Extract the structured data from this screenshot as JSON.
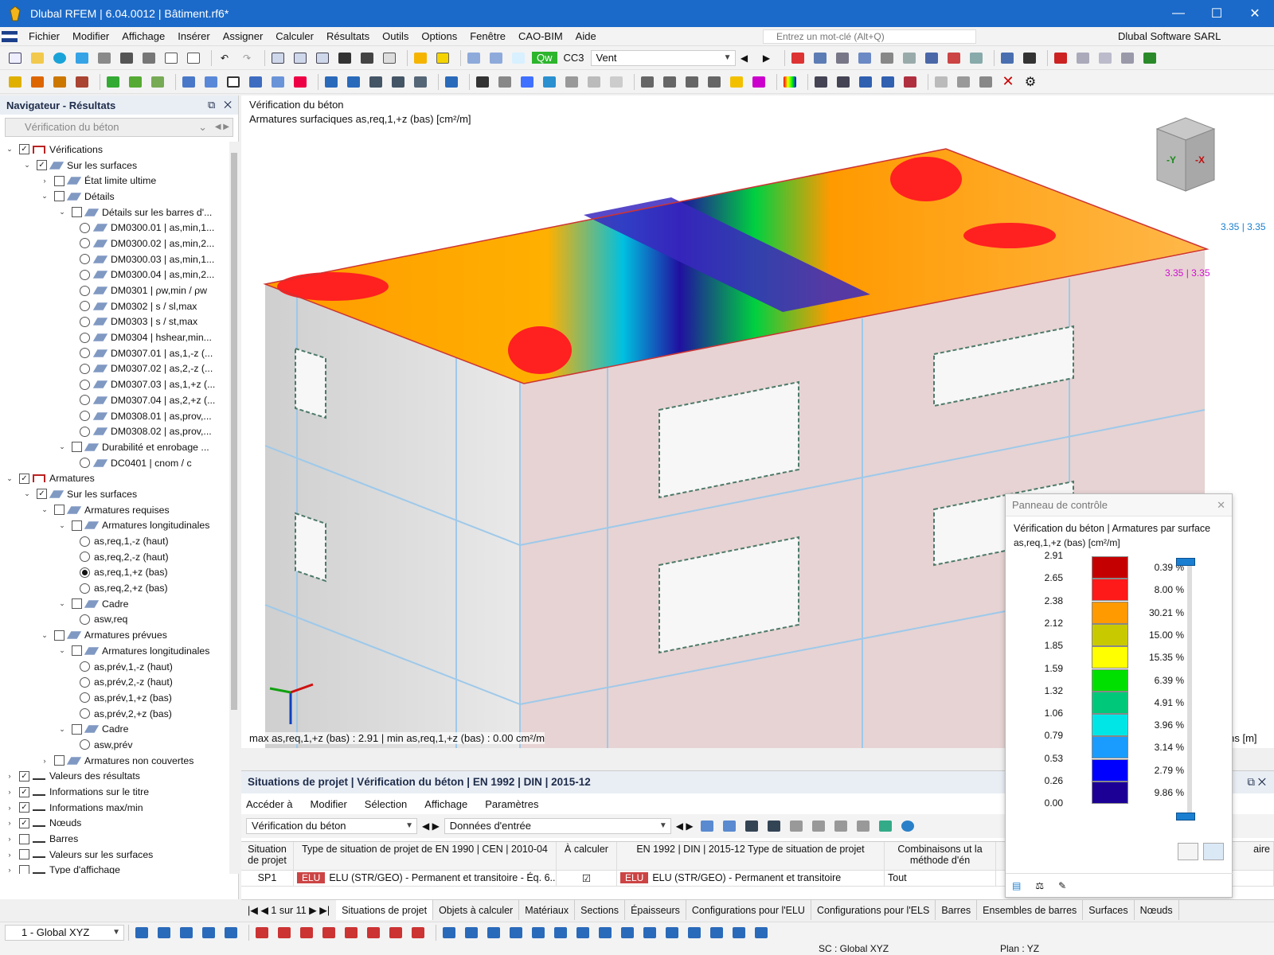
{
  "window": {
    "title": "Dlubal RFEM | 6.04.0012 | Bâtiment.rf6*",
    "minimize": "—",
    "maximize": "☐",
    "close": "✕"
  },
  "menu": {
    "items": [
      "Fichier",
      "Modifier",
      "Affichage",
      "Insérer",
      "Assigner",
      "Calculer",
      "Résultats",
      "Outils",
      "Options",
      "Fenêtre",
      "CAO-BIM",
      "Aide"
    ],
    "search_placeholder": "Entrez un mot-clé (Alt+Q)",
    "company": "Dlubal Software SARL"
  },
  "toolbar": {
    "load_case_code": "Qw",
    "load_case_id": "CC3",
    "load_case_name": "Vent"
  },
  "navigator": {
    "title": "Navigateur - Résultats",
    "selector": "Vérification du béton",
    "tree": [
      {
        "level": 0,
        "exp": "v",
        "check": "checked",
        "icon": "check",
        "label": "Vérifications"
      },
      {
        "level": 1,
        "exp": "v",
        "check": "checked",
        "icon": "surf",
        "label": "Sur les surfaces"
      },
      {
        "level": 2,
        "exp": ">",
        "check": "empty",
        "icon": "surf",
        "label": "État limite ultime"
      },
      {
        "level": 2,
        "exp": "v",
        "check": "empty",
        "icon": "surf",
        "label": "Détails"
      },
      {
        "level": 3,
        "exp": "v",
        "check": "empty",
        "icon": "surf",
        "label": "Détails sur les barres d'..."
      },
      {
        "level": 4,
        "radio": "off",
        "icon": "surf",
        "label": "DM0300.01 | as,min,1..."
      },
      {
        "level": 4,
        "radio": "off",
        "icon": "surf",
        "label": "DM0300.02 | as,min,2..."
      },
      {
        "level": 4,
        "radio": "off",
        "icon": "surf",
        "label": "DM0300.03 | as,min,1..."
      },
      {
        "level": 4,
        "radio": "off",
        "icon": "surf",
        "label": "DM0300.04 | as,min,2..."
      },
      {
        "level": 4,
        "radio": "off",
        "icon": "surf",
        "label": "DM0301 | ρw,min / ρw"
      },
      {
        "level": 4,
        "radio": "off",
        "icon": "surf",
        "label": "DM0302 | s / sl,max"
      },
      {
        "level": 4,
        "radio": "off",
        "icon": "surf",
        "label": "DM0303 | s / st,max"
      },
      {
        "level": 4,
        "radio": "off",
        "icon": "surf",
        "label": "DM0304 | hshear,min..."
      },
      {
        "level": 4,
        "radio": "off",
        "icon": "surf",
        "label": "DM0307.01 | as,1,-z (..."
      },
      {
        "level": 4,
        "radio": "off",
        "icon": "surf",
        "label": "DM0307.02 | as,2,-z (..."
      },
      {
        "level": 4,
        "radio": "off",
        "icon": "surf",
        "label": "DM0307.03 | as,1,+z (..."
      },
      {
        "level": 4,
        "radio": "off",
        "icon": "surf",
        "label": "DM0307.04 | as,2,+z (..."
      },
      {
        "level": 4,
        "radio": "off",
        "icon": "surf",
        "label": "DM0308.01 | as,prov,..."
      },
      {
        "level": 4,
        "radio": "off",
        "icon": "surf",
        "label": "DM0308.02 | as,prov,..."
      },
      {
        "level": 3,
        "exp": "v",
        "check": "empty",
        "icon": "surf",
        "label": "Durabilité et enrobage ..."
      },
      {
        "level": 4,
        "radio": "off",
        "icon": "surf",
        "label": "DC0401 | cnom / c"
      },
      {
        "level": 0,
        "exp": "v",
        "check": "checked",
        "icon": "check",
        "label": "Armatures"
      },
      {
        "level": 1,
        "exp": "v",
        "check": "checked",
        "icon": "surf",
        "label": "Sur les surfaces"
      },
      {
        "level": 2,
        "exp": "v",
        "check": "empty",
        "icon": "surf",
        "label": "Armatures requises"
      },
      {
        "level": 3,
        "exp": "v",
        "check": "empty",
        "icon": "surf",
        "label": "Armatures longitudinales"
      },
      {
        "level": 4,
        "radio": "off",
        "label": "as,req,1,-z (haut)"
      },
      {
        "level": 4,
        "radio": "off",
        "label": "as,req,2,-z (haut)"
      },
      {
        "level": 4,
        "radio": "on",
        "label": "as,req,1,+z (bas)"
      },
      {
        "level": 4,
        "radio": "off",
        "label": "as,req,2,+z (bas)"
      },
      {
        "level": 3,
        "exp": "v",
        "check": "empty",
        "icon": "surf",
        "label": "Cadre"
      },
      {
        "level": 4,
        "radio": "off",
        "label": "asw,req"
      },
      {
        "level": 2,
        "exp": "v",
        "check": "empty",
        "icon": "surf",
        "label": "Armatures prévues"
      },
      {
        "level": 3,
        "exp": "v",
        "check": "empty",
        "icon": "surf",
        "label": "Armatures longitudinales"
      },
      {
        "level": 4,
        "radio": "off",
        "label": "as,prév,1,-z (haut)"
      },
      {
        "level": 4,
        "radio": "off",
        "label": "as,prév,2,-z (haut)"
      },
      {
        "level": 4,
        "radio": "off",
        "label": "as,prév,1,+z (bas)"
      },
      {
        "level": 4,
        "radio": "off",
        "label": "as,prév,2,+z (bas)"
      },
      {
        "level": 3,
        "exp": "v",
        "check": "empty",
        "icon": "surf",
        "label": "Cadre"
      },
      {
        "level": 4,
        "radio": "off",
        "label": "asw,prév"
      },
      {
        "level": 2,
        "exp": ">",
        "check": "empty",
        "icon": "surf",
        "label": "Armatures non couvertes"
      },
      {
        "level": 0,
        "exp": ">",
        "check": "checked",
        "icon": "vals",
        "label": "Valeurs des résultats"
      },
      {
        "level": 0,
        "exp": ">",
        "check": "checked",
        "icon": "vals",
        "label": "Informations sur le titre"
      },
      {
        "level": 0,
        "exp": ">",
        "check": "checked",
        "icon": "vals",
        "label": "Informations max/min"
      },
      {
        "level": 0,
        "exp": ">",
        "check": "checked",
        "icon": "vals",
        "label": "Nœuds"
      },
      {
        "level": 0,
        "exp": ">",
        "check": "empty",
        "icon": "vals",
        "label": "Barres"
      },
      {
        "level": 0,
        "exp": ">",
        "check": "empty",
        "icon": "vals",
        "label": "Valeurs sur les surfaces"
      },
      {
        "level": 0,
        "exp": ">",
        "check": "empty",
        "icon": "vals",
        "label": "Type d'affichage"
      }
    ]
  },
  "viewport": {
    "title": "Vérification du béton",
    "subtitle": "Armatures surfaciques as,req,1,+z (bas) [cm²/m]",
    "maxmin": "max as,req,1,+z (bas) : 2.91 | min as,req,1,+z (bas) : 0.00 cm²/m",
    "label_right1": "3.35 | 3.35",
    "label_right2": "3.35 | 3.35",
    "label_units": "ions [m]",
    "cube_y": "-Y",
    "cube_x": "-X"
  },
  "control_panel": {
    "title": "Panneau de contrôle",
    "heading": "Vérification du béton | Armatures par surface",
    "subheading": "as,req,1,+z (bas) [cm²/m]",
    "values": [
      "2.91",
      "2.65",
      "2.38",
      "2.12",
      "1.85",
      "1.59",
      "1.32",
      "1.06",
      "0.79",
      "0.53",
      "0.26",
      "0.00"
    ],
    "colors": [
      "#c40000",
      "#ff1a1a",
      "#ff9a00",
      "#c9c900",
      "#ffff00",
      "#00e000",
      "#00c87a",
      "#00e6e6",
      "#1a9cff",
      "#0000ff",
      "#1c0096"
    ],
    "percents": [
      "0.39 %",
      "8.00 %",
      "30.21 %",
      "15.00 %",
      "15.35 %",
      "6.39 %",
      "4.91 %",
      "3.96 %",
      "3.14 %",
      "2.79 %",
      "9.86 %"
    ]
  },
  "bottom_panel": {
    "title": "Situations de projet | Vérification du béton | EN 1992 | DIN | 2015-12",
    "menu": [
      "Accéder à",
      "Modifier",
      "Sélection",
      "Affichage",
      "Paramètres"
    ],
    "dropdown1": "Vérification du béton",
    "dropdown2": "Données d'entrée",
    "headers": [
      "Situation de projet",
      "Type de situation de projet de EN 1990 | CEN | 2010-04",
      "À calculer",
      "EN 1992 | DIN | 2015-12 Type de situation de projet",
      "Combinaisons ut la méthode d'én",
      "aire"
    ],
    "row": {
      "id": "SP1",
      "badge": "ELU",
      "type": "ELU (STR/GEO) - Permanent et transitoire - Éq. 6....",
      "calc": "☑",
      "badge2": "ELU",
      "type2": "ELU (STR/GEO) - Permanent et transitoire",
      "comb": "Tout"
    },
    "pager": "1 sur 11",
    "tabs": [
      "Situations de projet",
      "Objets à calculer",
      "Matériaux",
      "Sections",
      "Épaisseurs",
      "Configurations pour l'ELU",
      "Configurations pour l'ELS",
      "Barres",
      "Ensembles de barres",
      "Surfaces",
      "Nœuds"
    ]
  },
  "status": {
    "view": "1 - Global XYZ",
    "sc": "SC : Global XYZ",
    "plan": "Plan : YZ"
  }
}
